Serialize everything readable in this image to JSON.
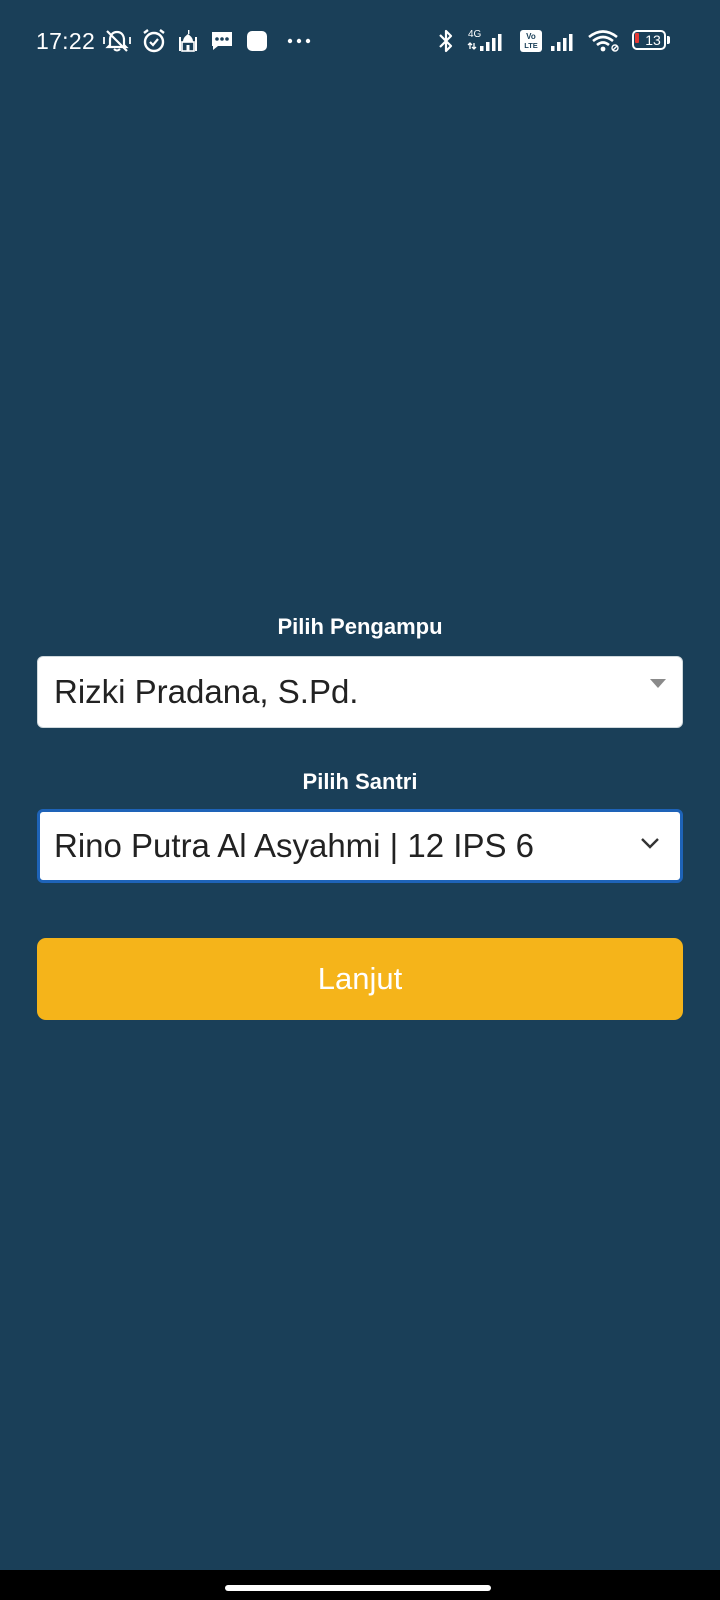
{
  "status_bar": {
    "time": "17:22",
    "network_label": "4G",
    "volte_label_top": "Vo",
    "volte_label_bottom": "LTE",
    "battery_level": "13",
    "icons": [
      "mute-vibrate-icon",
      "alarm-icon",
      "mosque-icon",
      "message-icon",
      "app-icon",
      "more-icon",
      "bluetooth-icon",
      "signal-4g-icon",
      "volte-icon",
      "signal-icon",
      "wifi-icon",
      "battery-icon"
    ],
    "battery_low_color": "#e53935"
  },
  "form": {
    "pengampu": {
      "label": "Pilih Pengampu",
      "selected": "Rizki Pradana, S.Pd."
    },
    "santri": {
      "label": "Pilih Santri",
      "selected": "Rino Putra Al Asyahmi | 12 IPS 6"
    },
    "submit_label": "Lanjut"
  },
  "colors": {
    "background": "#1a3f58",
    "accent": "#f5b41a",
    "focus_border": "#1e63b8"
  }
}
